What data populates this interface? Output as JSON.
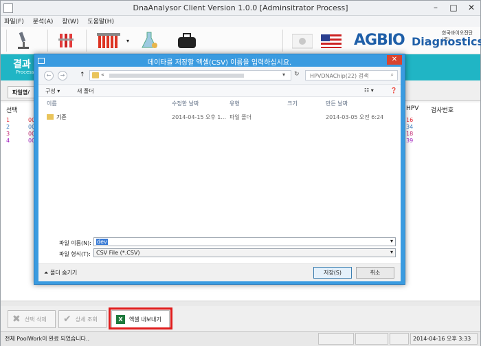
{
  "window": {
    "title": "DnaAnalysor Client Version 1.0.0 [Adminsitrator Process]"
  },
  "menu": [
    "파일(F)",
    "분석(A)",
    "창(W)",
    "도움말(H)"
  ],
  "brand": {
    "name_ag": "AGBIO",
    "name_dx": "Diagnostics",
    "korean": "한국바이오진단(주)",
    "color": "#1f5fa8"
  },
  "ribbon": {
    "title": "결과",
    "subtitle": "Process",
    "color": "#20b5c5"
  },
  "subbar": {
    "tab_label": "파일명/"
  },
  "grid": {
    "headers": {
      "select": "선택",
      "hpv": "HPV",
      "test_no": "검사번호"
    },
    "rows": [
      {
        "no": "1",
        "col2": "00",
        "hpv": "16",
        "color": "#e0202e"
      },
      {
        "no": "2",
        "col2": "00",
        "hpv": "34",
        "color": "#3f7fbf"
      },
      {
        "no": "3",
        "col2": "00",
        "hpv": "18",
        "color": "#c0206d"
      },
      {
        "no": "4",
        "col2": "00",
        "hpv": "39",
        "color": "#a020c0"
      }
    ]
  },
  "bottom_buttons": {
    "delete": "선택 삭제",
    "detail": "상세 조회",
    "export": "엑셀 내보내기"
  },
  "status": {
    "message": "전체 PoolWork이 완료 되었습니다..",
    "datetime": "2014-04-16 오후 3:33"
  },
  "dialog": {
    "title": "데이타를 저장할 엑셀(CSV) 이름을 입력하십시요.",
    "address_prefix": "«",
    "search_placeholder": "HPVDNAChip(22) 검색",
    "cmd_organize": "구성 ▾",
    "cmd_new_folder": "새 폴더",
    "columns": [
      "이름",
      "수정한 날짜",
      "유형",
      "크기",
      "만든 날짜"
    ],
    "files": [
      {
        "name": "기존",
        "modified": "2014-04-15 오후 1...",
        "type": "파일 폴더",
        "size": "",
        "created": "2014-03-05 오전 6:24"
      }
    ],
    "filename_label": "파일 이름(N):",
    "filename_value": "dev",
    "filetype_label": "파일 형식(T):",
    "filetype_value": "CSV File (*.CSV)",
    "hide_folders": "폴더 숨기기",
    "save": "저장(S)",
    "cancel": "취소",
    "accent": "#3a9be0"
  }
}
